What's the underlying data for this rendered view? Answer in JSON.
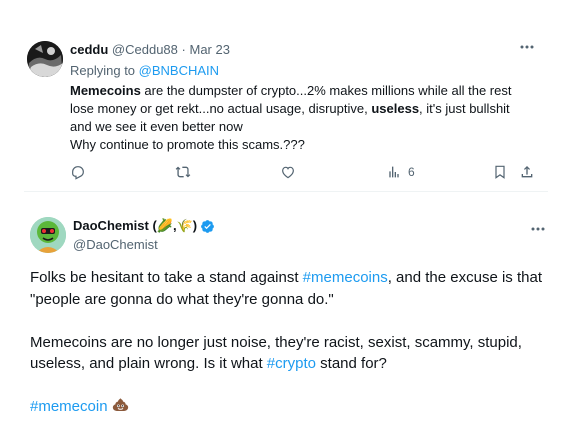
{
  "reply": {
    "author_name": "ceddu",
    "author_handle": "@Ceddu88",
    "separator": "·",
    "date": "Mar 23",
    "replying_prefix": "Replying to",
    "replying_handle": "@BNBCHAIN",
    "body": {
      "l1_bold": "Memecoins",
      "l1_text": " are the dumpster of crypto...2% makes millions while all the rest lose money or get rekt...no actual usage, disruptive, ",
      "l1_bold2": "useless",
      "l1_text2": ", it's just bullshit and we see it even better now",
      "l2": "Why continue to promote this scams.???"
    },
    "actions": {
      "reply_icon": "reply-icon",
      "retweet_icon": "retweet-icon",
      "like_icon": "like-icon",
      "views_icon": "views-icon",
      "views_count": "6",
      "bookmark_icon": "bookmark-icon",
      "share_icon": "share-icon"
    }
  },
  "main": {
    "author_name": "DaoChemist (🌽,🌾)",
    "author_handle": "@DaoChemist",
    "verified_icon": "verified-badge-icon",
    "body": {
      "p1_a": "Folks be hesitant to take a stand against ",
      "p1_hash": "#memecoins",
      "p1_b": ", and the excuse is that \"people are gonna do what they're gonna do.\"",
      "p2_a": "Memecoins are no longer just noise, they're racist, sexist, scammy, stupid, useless, and plain wrong. Is it what ",
      "p2_hash": "#crypto",
      "p2_b": " stand for?",
      "p3_hash": "#memecoin",
      "p3_emoji_icon": "pile-of-poo-emoji"
    }
  },
  "colors": {
    "text": "#0f1419",
    "secondary": "#536471",
    "link": "#1d9bf0",
    "divider": "#eff3f4"
  }
}
